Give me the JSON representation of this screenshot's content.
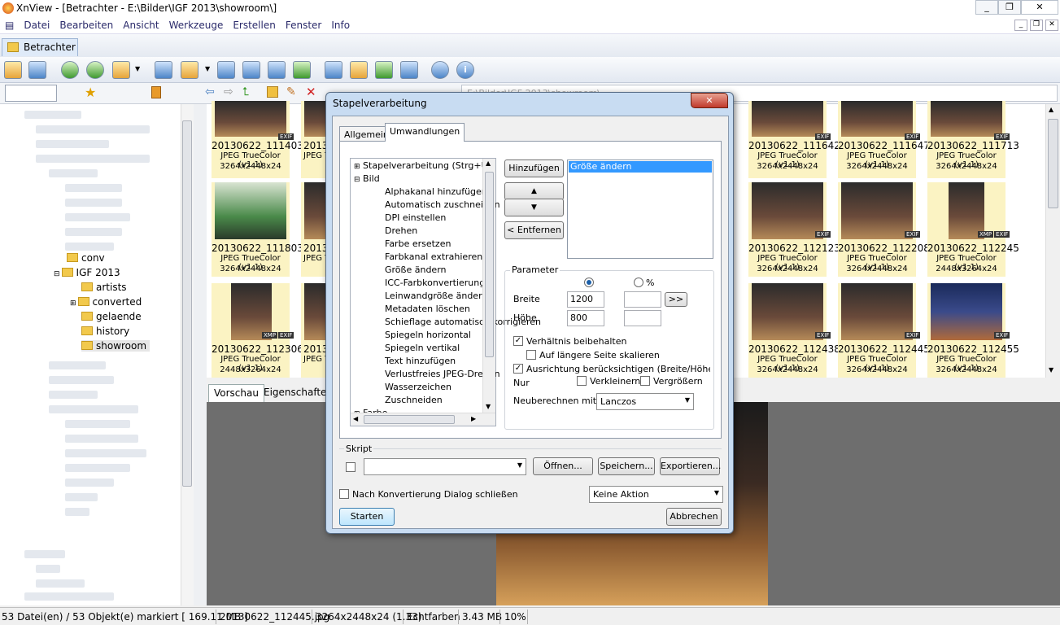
{
  "window": {
    "title": "XnView - [Betrachter - E:\\Bilder\\IGF 2013\\showroom\\]"
  },
  "menu": [
    "Datei",
    "Bearbeiten",
    "Ansicht",
    "Werkzeuge",
    "Erstellen",
    "Fenster",
    "Info"
  ],
  "tab": {
    "label": "Betrachter"
  },
  "path": {
    "value": "E:\\Bilder\\IGF 2013\\showroom\\"
  },
  "tree": {
    "items": [
      {
        "label": "conv"
      },
      {
        "label": "IGF 2013"
      },
      {
        "label": "artists"
      },
      {
        "label": "converted"
      },
      {
        "label": "gelaende"
      },
      {
        "label": "history"
      },
      {
        "label": "showroom"
      }
    ]
  },
  "thumbs": [
    {
      "name": "20130622_111403",
      "format": "JPEG TrueColor (v1.1)",
      "dims": "3264x2448x24"
    },
    {
      "name": "20130622_111642",
      "format": "JPEG TrueColor (v1.1)",
      "dims": "3264x2448x24"
    },
    {
      "name": "20130622_111647",
      "format": "JPEG TrueColor (v1.1)",
      "dims": "3264x2448x24"
    },
    {
      "name": "20130622_111713",
      "format": "JPEG TrueColor (v1.1)",
      "dims": "3264x2448x24"
    },
    {
      "name": "20130622_111803",
      "format": "JPEG TrueColor (v1.1)",
      "dims": "3264x2448x24"
    },
    {
      "name": "20130622_112123",
      "format": "JPEG TrueColor (v1.1)",
      "dims": "3264x2448x24"
    },
    {
      "name": "20130622_112208",
      "format": "JPEG TrueColor (v1.1)",
      "dims": "3264x2448x24"
    },
    {
      "name": "20130622_112245",
      "format": "JPEG TrueColor (v1.1)",
      "dims": "2448x3264x24"
    },
    {
      "name": "20130622_112306",
      "format": "JPEG TrueColor (v1.1)",
      "dims": "2448x3264x24"
    },
    {
      "name": "20130622_112438",
      "format": "JPEG TrueColor (v1.1)",
      "dims": "3264x2448x24"
    },
    {
      "name": "20130622_112445",
      "format": "JPEG TrueColor (v1.1)",
      "dims": "3264x2448x24"
    },
    {
      "name": "20130622_112455",
      "format": "JPEG TrueColor (v1.1)",
      "dims": "3264x2448x24"
    }
  ],
  "partial_names": {
    "a": "20130",
    "b": "2013",
    "c": "2013"
  },
  "partial_formats": {
    "a": "JPEG T",
    "b": "JPEG T",
    "c": "JPEG T"
  },
  "badges": {
    "exif": "EXIF",
    "xmp": "XMP"
  },
  "preview_tabs": [
    "Vorschau",
    "Eigenschaften"
  ],
  "status": {
    "files": "53 Datei(en) / 53 Objekt(e) markiert  [ 169.11 MB ]",
    "filename": "20130622_112445.jpg",
    "dims": "3264x2448x24 (1.33)",
    "color": "Echtfarben",
    "size": "3.43 MB",
    "zoom": "10%"
  },
  "dialog": {
    "title": "Stapelverarbeitung",
    "tabs": [
      "Allgemein",
      "Umwandlungen"
    ],
    "tree_root1": "Stapelverarbeitung  (Strg+U)",
    "tree_root2": "Bild",
    "tree_root3": "Farbe",
    "tree_items": [
      "Alphakanal hinzufügen",
      "Automatisch zuschneiden",
      "DPI einstellen",
      "Drehen",
      "Farbe ersetzen",
      "Farbkanal extrahieren",
      "Größe ändern",
      "ICC-Farbkonvertierung",
      "Leinwandgröße ändern",
      "Metadaten löschen",
      "Schieflage automatisch korrigieren",
      "Spiegeln horizontal",
      "Spiegeln vertikal",
      "Text hinzufügen",
      "Verlustfreies JPEG-Drehen",
      "Wasserzeichen",
      "Zuschneiden"
    ],
    "add_button": "Hinzufügen >",
    "up_button": "▲",
    "down_button": "▼",
    "remove_button": "< Entfernen",
    "selected_item": "Größe ändern",
    "param_label": "Parameter",
    "percent_label": "%",
    "width_label": "Breite",
    "width_value": "1200",
    "height_label": "Höhe",
    "height_value": "800",
    "copy_button": ">>",
    "keep_ratio": "Verhältnis beibehalten",
    "longer_side": "Auf längere Seite skalieren",
    "orientation": "Ausrichtung berücksichtigen (Breite/Höhe tauschen)",
    "only_label": "Nur",
    "shrink_label": "Verkleinern",
    "enlarge_label": "Vergrößern",
    "resample_label": "Neuberechnen mit",
    "resample_value": "Lanczos",
    "script_label": "Skript",
    "open_button": "Öffnen...",
    "save_button": "Speichern...",
    "export_button": "Exportieren...",
    "close_after": "Nach Konvertierung Dialog schließen",
    "action_value": "Keine Aktion",
    "start_button": "Starten",
    "cancel_button": "Abbrechen"
  }
}
